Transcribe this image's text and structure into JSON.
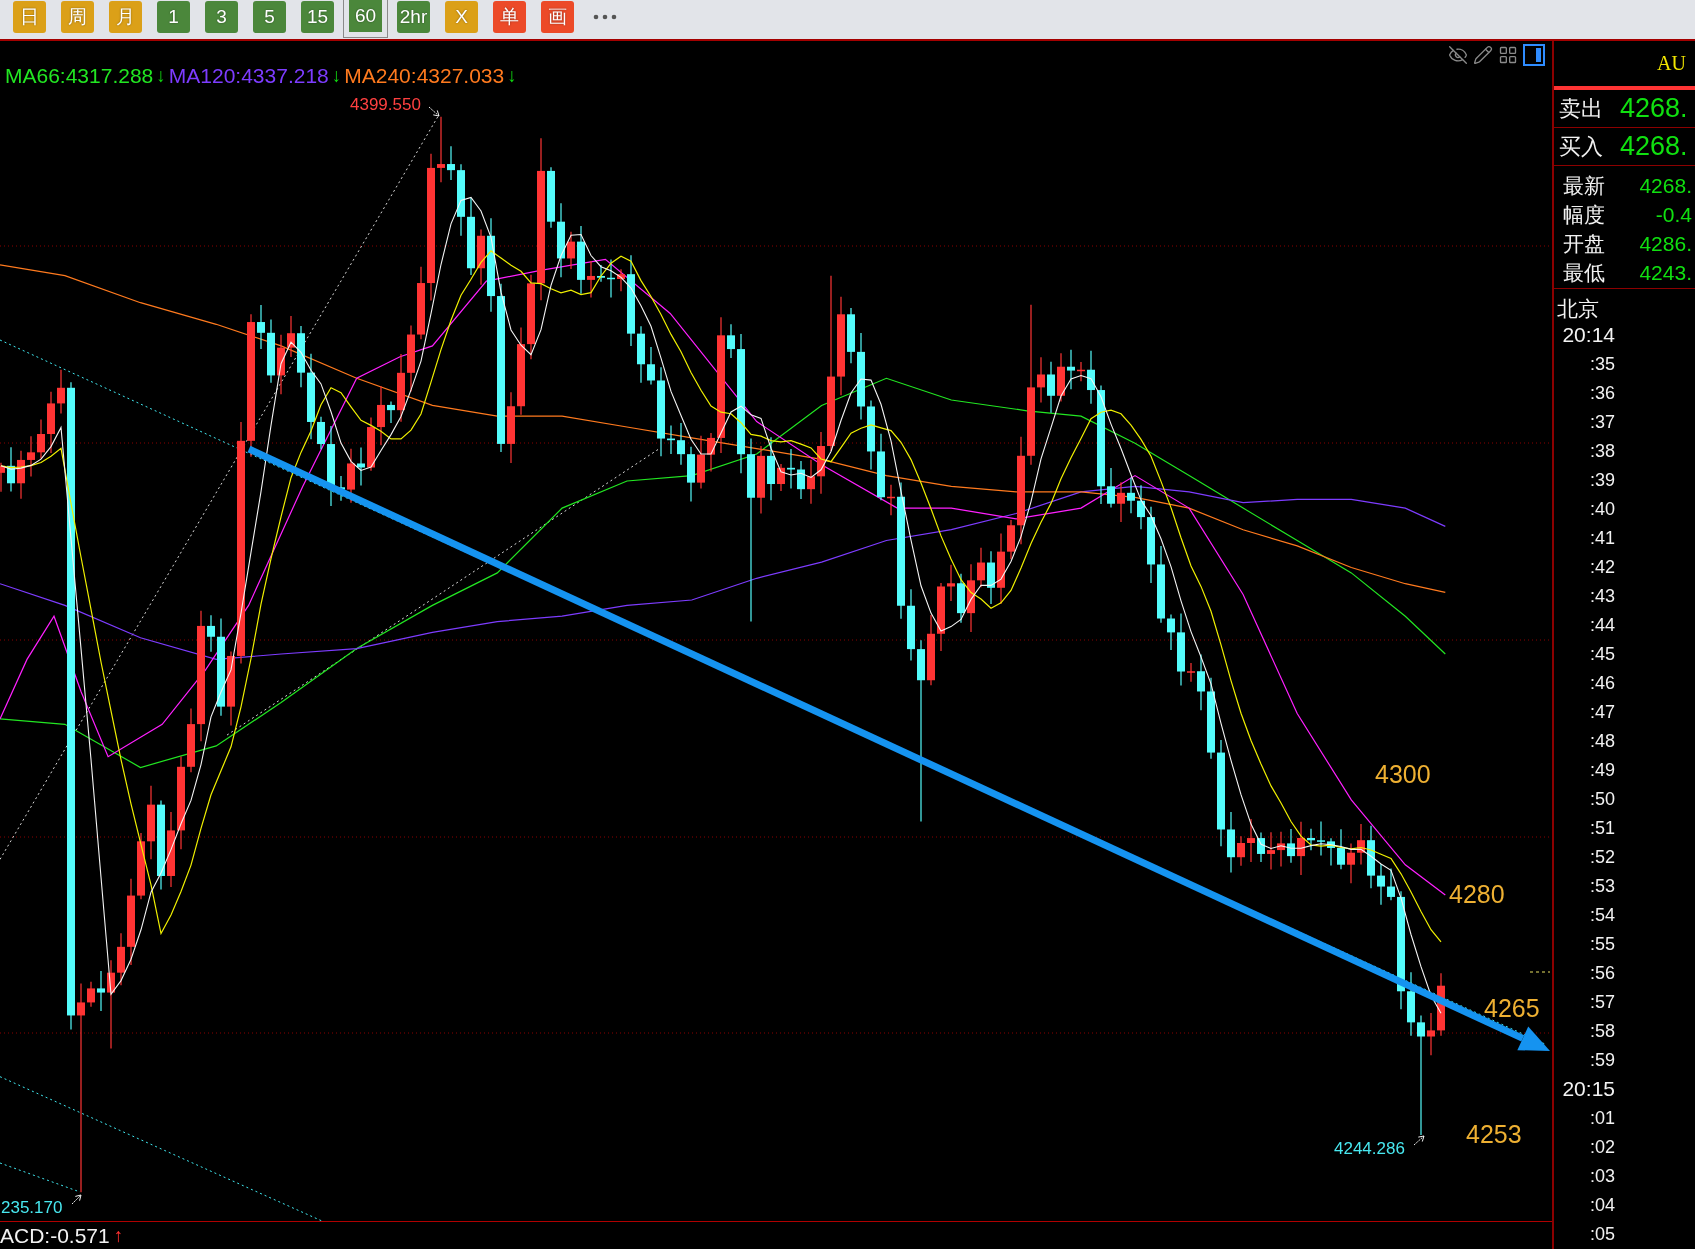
{
  "toolbar": {
    "buttons": [
      {
        "label": "日",
        "color": "#dba018",
        "selected": false
      },
      {
        "label": "周",
        "color": "#dba018",
        "selected": false
      },
      {
        "label": "月",
        "color": "#dba018",
        "selected": false
      },
      {
        "label": "1",
        "color": "#4b873b",
        "selected": false
      },
      {
        "label": "3",
        "color": "#4b873b",
        "selected": false
      },
      {
        "label": "5",
        "color": "#4b873b",
        "selected": false
      },
      {
        "label": "15",
        "color": "#4b873b",
        "selected": false
      },
      {
        "label": "60",
        "color": "#4b873b",
        "selected": true
      },
      {
        "label": "2hr",
        "color": "#4b873b",
        "selected": false
      },
      {
        "label": "X",
        "color": "#dba018",
        "selected": false
      },
      {
        "label": "单",
        "color": "#ec4a28",
        "selected": false
      },
      {
        "label": "画",
        "color": "#ec4a28",
        "selected": false
      }
    ]
  },
  "chart": {
    "ma_legend": [
      {
        "label": "MA66:4317.288",
        "color": "#22e622",
        "trend": "↓"
      },
      {
        "label": "MA120:4337.218",
        "color": "#7d3cff",
        "trend": "↓"
      },
      {
        "label": "MA240:4327.033",
        "color": "#ff7a1e",
        "trend": "↓"
      }
    ],
    "high_label": "4399.550",
    "low_label": "4244.286",
    "edge_label": "235.170",
    "price_notes": [
      "4300",
      "4280",
      "4265",
      "4253"
    ]
  },
  "indicator": {
    "label": "ACD:-0.571",
    "trend": "↑"
  },
  "quote_panel": {
    "symbol": "AU",
    "orders": [
      {
        "label": "卖出",
        "value": "4268."
      },
      {
        "label": "买入",
        "value": "4268."
      }
    ],
    "stats": [
      {
        "label": "最新",
        "value": "4268."
      },
      {
        "label": "幅度",
        "value": "-0.4"
      },
      {
        "label": "开盘",
        "value": "4286."
      },
      {
        "label": "最低",
        "value": "4243."
      }
    ],
    "timezone": "北京",
    "times": [
      {
        "text": "20:14",
        "kind": "hour"
      },
      {
        "text": ":35",
        "kind": "minute"
      },
      {
        "text": ":36",
        "kind": "minute"
      },
      {
        "text": ":37",
        "kind": "minute"
      },
      {
        "text": ":38",
        "kind": "minute"
      },
      {
        "text": ":39",
        "kind": "minute"
      },
      {
        "text": ":40",
        "kind": "minute"
      },
      {
        "text": ":41",
        "kind": "minute"
      },
      {
        "text": ":42",
        "kind": "minute"
      },
      {
        "text": ":43",
        "kind": "minute"
      },
      {
        "text": ":44",
        "kind": "minute"
      },
      {
        "text": ":45",
        "kind": "minute"
      },
      {
        "text": ":46",
        "kind": "minute"
      },
      {
        "text": ":47",
        "kind": "minute"
      },
      {
        "text": ":48",
        "kind": "minute"
      },
      {
        "text": ":49",
        "kind": "minute"
      },
      {
        "text": ":50",
        "kind": "minute"
      },
      {
        "text": ":51",
        "kind": "minute"
      },
      {
        "text": ":52",
        "kind": "minute"
      },
      {
        "text": ":53",
        "kind": "minute"
      },
      {
        "text": ":54",
        "kind": "minute"
      },
      {
        "text": ":55",
        "kind": "minute"
      },
      {
        "text": ":56",
        "kind": "minute"
      },
      {
        "text": ":57",
        "kind": "minute"
      },
      {
        "text": ":58",
        "kind": "minute"
      },
      {
        "text": ":59",
        "kind": "minute"
      },
      {
        "text": "20:15",
        "kind": "hour"
      },
      {
        "text": ":01",
        "kind": "minute"
      },
      {
        "text": ":02",
        "kind": "minute"
      },
      {
        "text": ":03",
        "kind": "minute"
      },
      {
        "text": ":04",
        "kind": "minute"
      },
      {
        "text": ":05",
        "kind": "minute"
      }
    ]
  }
}
